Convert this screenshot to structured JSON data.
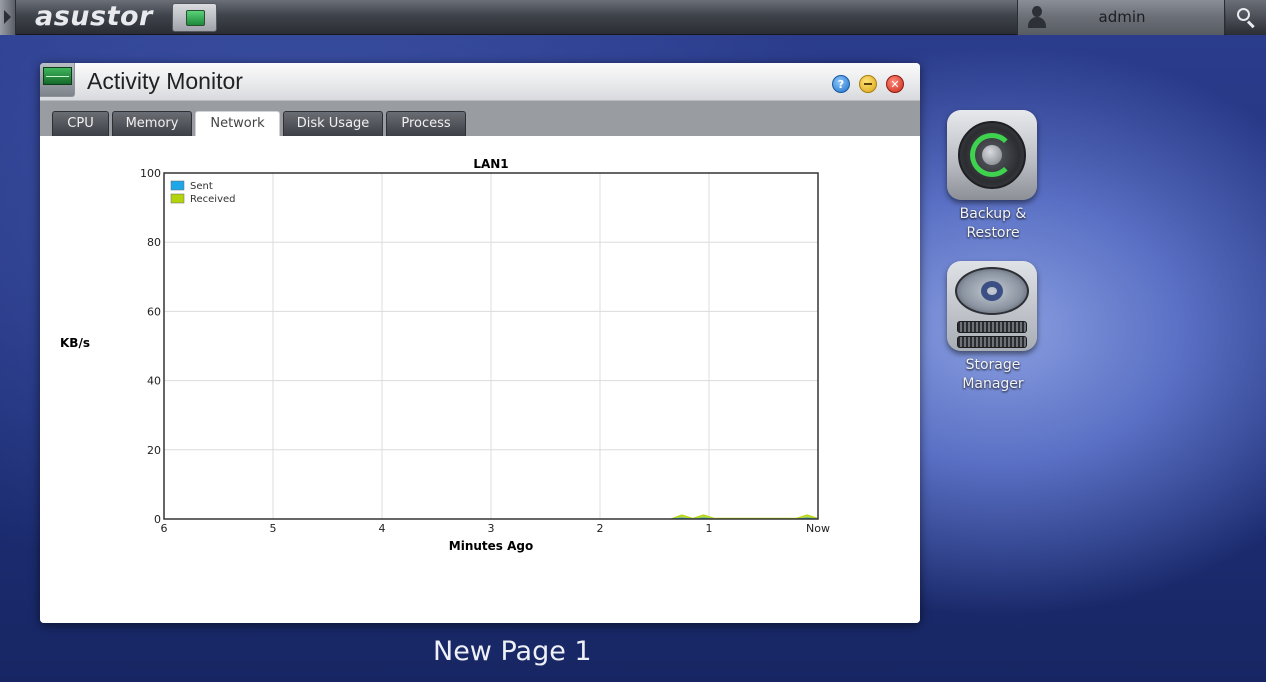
{
  "topbar": {
    "brand": "asustor",
    "user_name": "admin"
  },
  "window": {
    "title": "Activity Monitor",
    "controls": {
      "help_icon": "question-mark-icon",
      "minimize_icon": "minimize-icon",
      "close_icon": "close-icon"
    },
    "tabs": [
      {
        "label": "CPU",
        "active": false
      },
      {
        "label": "Memory",
        "active": false
      },
      {
        "label": "Network",
        "active": true
      },
      {
        "label": "Disk Usage",
        "active": false
      },
      {
        "label": "Process",
        "active": false
      }
    ]
  },
  "chart_data": {
    "type": "area",
    "title": "LAN1",
    "xlabel": "Minutes Ago",
    "ylabel": "KB/s",
    "ylim": [
      0,
      100
    ],
    "xlim": [
      6,
      0
    ],
    "yticks": [
      0,
      20,
      40,
      60,
      80,
      100
    ],
    "xticks": [
      "6",
      "5",
      "4",
      "3",
      "2",
      "1",
      "Now"
    ],
    "grid": true,
    "legend_position": "top-left",
    "series": [
      {
        "name": "Sent",
        "color": "#1ea7e8",
        "x": [
          6,
          5,
          4,
          3,
          2,
          1.35,
          1.25,
          1.15,
          1.05,
          0.95,
          0.85,
          0.5,
          0.2,
          0.1,
          0
        ],
        "y": [
          0,
          0,
          0,
          0,
          0,
          0,
          0.3,
          0,
          0.3,
          0,
          0,
          0,
          0,
          0.3,
          0
        ]
      },
      {
        "name": "Received",
        "color": "#b5d30d",
        "x": [
          6,
          5,
          4,
          3,
          2,
          1.35,
          1.25,
          1.15,
          1.05,
          0.95,
          0.85,
          0.5,
          0.2,
          0.1,
          0
        ],
        "y": [
          0,
          0,
          0,
          0,
          0,
          0,
          1.2,
          0.2,
          1.2,
          0.2,
          0.2,
          0.2,
          0.2,
          1.2,
          0.2
        ]
      }
    ]
  },
  "desktop": {
    "icons": [
      {
        "label_line1": "Backup &",
        "label_line2": "Restore",
        "icon": "backup-restore-icon"
      },
      {
        "label_line1": "Storage",
        "label_line2": "Manager",
        "icon": "storage-manager-icon"
      }
    ]
  },
  "page_label": "New Page 1"
}
